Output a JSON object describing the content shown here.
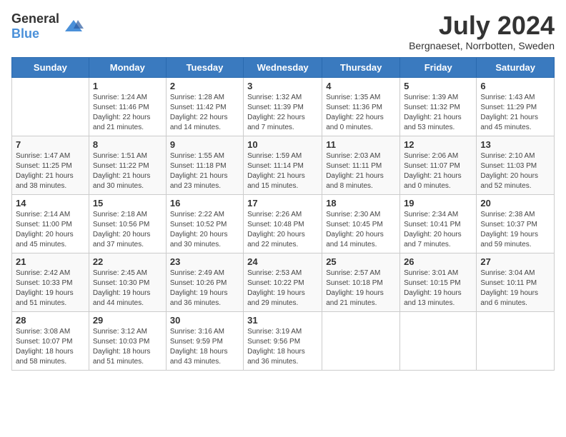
{
  "header": {
    "logo_general": "General",
    "logo_blue": "Blue",
    "month_title": "July 2024",
    "subtitle": "Bergnaeset, Norrbotten, Sweden"
  },
  "days_of_week": [
    "Sunday",
    "Monday",
    "Tuesday",
    "Wednesday",
    "Thursday",
    "Friday",
    "Saturday"
  ],
  "weeks": [
    [
      {
        "day": "",
        "info": ""
      },
      {
        "day": "1",
        "info": "Sunrise: 1:24 AM\nSunset: 11:46 PM\nDaylight: 22 hours and 21 minutes."
      },
      {
        "day": "2",
        "info": "Sunrise: 1:28 AM\nSunset: 11:42 PM\nDaylight: 22 hours and 14 minutes."
      },
      {
        "day": "3",
        "info": "Sunrise: 1:32 AM\nSunset: 11:39 PM\nDaylight: 22 hours and 7 minutes."
      },
      {
        "day": "4",
        "info": "Sunrise: 1:35 AM\nSunset: 11:36 PM\nDaylight: 22 hours and 0 minutes."
      },
      {
        "day": "5",
        "info": "Sunrise: 1:39 AM\nSunset: 11:32 PM\nDaylight: 21 hours and 53 minutes."
      },
      {
        "day": "6",
        "info": "Sunrise: 1:43 AM\nSunset: 11:29 PM\nDaylight: 21 hours and 45 minutes."
      }
    ],
    [
      {
        "day": "7",
        "info": "Sunrise: 1:47 AM\nSunset: 11:25 PM\nDaylight: 21 hours and 38 minutes."
      },
      {
        "day": "8",
        "info": "Sunrise: 1:51 AM\nSunset: 11:22 PM\nDaylight: 21 hours and 30 minutes."
      },
      {
        "day": "9",
        "info": "Sunrise: 1:55 AM\nSunset: 11:18 PM\nDaylight: 21 hours and 23 minutes."
      },
      {
        "day": "10",
        "info": "Sunrise: 1:59 AM\nSunset: 11:14 PM\nDaylight: 21 hours and 15 minutes."
      },
      {
        "day": "11",
        "info": "Sunrise: 2:03 AM\nSunset: 11:11 PM\nDaylight: 21 hours and 8 minutes."
      },
      {
        "day": "12",
        "info": "Sunrise: 2:06 AM\nSunset: 11:07 PM\nDaylight: 21 hours and 0 minutes."
      },
      {
        "day": "13",
        "info": "Sunrise: 2:10 AM\nSunset: 11:03 PM\nDaylight: 20 hours and 52 minutes."
      }
    ],
    [
      {
        "day": "14",
        "info": "Sunrise: 2:14 AM\nSunset: 11:00 PM\nDaylight: 20 hours and 45 minutes."
      },
      {
        "day": "15",
        "info": "Sunrise: 2:18 AM\nSunset: 10:56 PM\nDaylight: 20 hours and 37 minutes."
      },
      {
        "day": "16",
        "info": "Sunrise: 2:22 AM\nSunset: 10:52 PM\nDaylight: 20 hours and 30 minutes."
      },
      {
        "day": "17",
        "info": "Sunrise: 2:26 AM\nSunset: 10:48 PM\nDaylight: 20 hours and 22 minutes."
      },
      {
        "day": "18",
        "info": "Sunrise: 2:30 AM\nSunset: 10:45 PM\nDaylight: 20 hours and 14 minutes."
      },
      {
        "day": "19",
        "info": "Sunrise: 2:34 AM\nSunset: 10:41 PM\nDaylight: 20 hours and 7 minutes."
      },
      {
        "day": "20",
        "info": "Sunrise: 2:38 AM\nSunset: 10:37 PM\nDaylight: 19 hours and 59 minutes."
      }
    ],
    [
      {
        "day": "21",
        "info": "Sunrise: 2:42 AM\nSunset: 10:33 PM\nDaylight: 19 hours and 51 minutes."
      },
      {
        "day": "22",
        "info": "Sunrise: 2:45 AM\nSunset: 10:30 PM\nDaylight: 19 hours and 44 minutes."
      },
      {
        "day": "23",
        "info": "Sunrise: 2:49 AM\nSunset: 10:26 PM\nDaylight: 19 hours and 36 minutes."
      },
      {
        "day": "24",
        "info": "Sunrise: 2:53 AM\nSunset: 10:22 PM\nDaylight: 19 hours and 29 minutes."
      },
      {
        "day": "25",
        "info": "Sunrise: 2:57 AM\nSunset: 10:18 PM\nDaylight: 19 hours and 21 minutes."
      },
      {
        "day": "26",
        "info": "Sunrise: 3:01 AM\nSunset: 10:15 PM\nDaylight: 19 hours and 13 minutes."
      },
      {
        "day": "27",
        "info": "Sunrise: 3:04 AM\nSunset: 10:11 PM\nDaylight: 19 hours and 6 minutes."
      }
    ],
    [
      {
        "day": "28",
        "info": "Sunrise: 3:08 AM\nSunset: 10:07 PM\nDaylight: 18 hours and 58 minutes."
      },
      {
        "day": "29",
        "info": "Sunrise: 3:12 AM\nSunset: 10:03 PM\nDaylight: 18 hours and 51 minutes."
      },
      {
        "day": "30",
        "info": "Sunrise: 3:16 AM\nSunset: 9:59 PM\nDaylight: 18 hours and 43 minutes."
      },
      {
        "day": "31",
        "info": "Sunrise: 3:19 AM\nSunset: 9:56 PM\nDaylight: 18 hours and 36 minutes."
      },
      {
        "day": "",
        "info": ""
      },
      {
        "day": "",
        "info": ""
      },
      {
        "day": "",
        "info": ""
      }
    ]
  ]
}
